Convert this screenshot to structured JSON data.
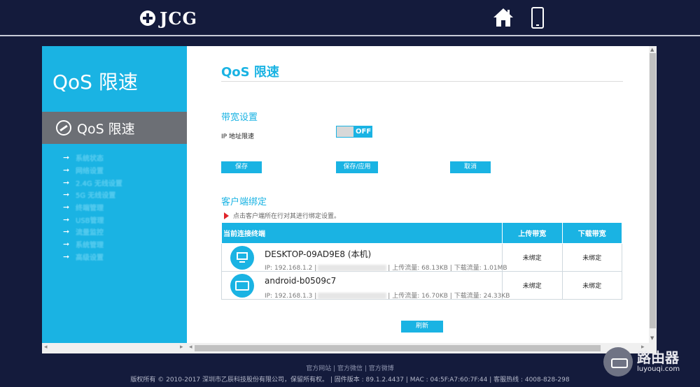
{
  "header": {
    "logo_text": "JCG",
    "icons": [
      "home-icon",
      "phone-icon"
    ]
  },
  "sidebar": {
    "title": "QoS 限速",
    "active_item": "QoS 限速",
    "items": [
      {
        "label": "系统状态"
      },
      {
        "label": "网络设置"
      },
      {
        "label": "2.4G 无线设置"
      },
      {
        "label": "5G 无线设置"
      },
      {
        "label": "终端管理"
      },
      {
        "label": "USB管理"
      },
      {
        "label": "流量监控"
      },
      {
        "label": "系统管理"
      },
      {
        "label": "高级设置"
      }
    ]
  },
  "main": {
    "title": "QoS 限速",
    "bandwidth": {
      "section_title": "带宽设置",
      "ip_limit_label": "IP 地址限速",
      "toggle_state": "OFF",
      "buttons": {
        "save": "保存",
        "save_apply": "保存/应用",
        "cancel": "取消"
      }
    },
    "client_binding": {
      "section_title": "客户端绑定",
      "hint": "点击客户端所在行对其进行绑定设置。",
      "table": {
        "headers": [
          "当前连接终端",
          "上传带宽",
          "下载带宽"
        ],
        "rows": [
          {
            "name": "DESKTOP-09AD9E8 (本机)",
            "ip": "IP: 192.168.1.2",
            "upload_traffic": "上传流量: 68.13KB",
            "download_traffic": "下载流量: 1.01MB",
            "upload_bw": "未绑定",
            "download_bw": "未绑定",
            "icon": "monitor-icon"
          },
          {
            "name": "android-b0509c7",
            "ip": "IP: 192.168.1.3",
            "upload_traffic": "上传流量: 16.70KB",
            "download_traffic": "下载流量: 24.33KB",
            "upload_bw": "未绑定",
            "download_bw": "未绑定",
            "icon": "tablet-icon"
          }
        ]
      },
      "refresh_label": "刷新"
    }
  },
  "footer": {
    "link_official_site": "官方网站",
    "link_wechat": "官方微信",
    "link_weibo": "官方微博",
    "copyright": "版权所有 © 2010-2017 深圳市乙辰科技股份有限公司，保留所有权。",
    "firmware": "固件版本 : 89.1.2.4437",
    "mac": "MAC : 04:5F:A7:60:7F:44",
    "hotline": "客服热线 : 4008-828-298"
  },
  "watermark": {
    "cn": "路由器",
    "en": "luyouqi.com"
  },
  "colors": {
    "accent": "#1ab3e3",
    "background": "#141b3c",
    "sidebar_active": "#6c6f75",
    "hint_arrow": "#e0242a"
  }
}
